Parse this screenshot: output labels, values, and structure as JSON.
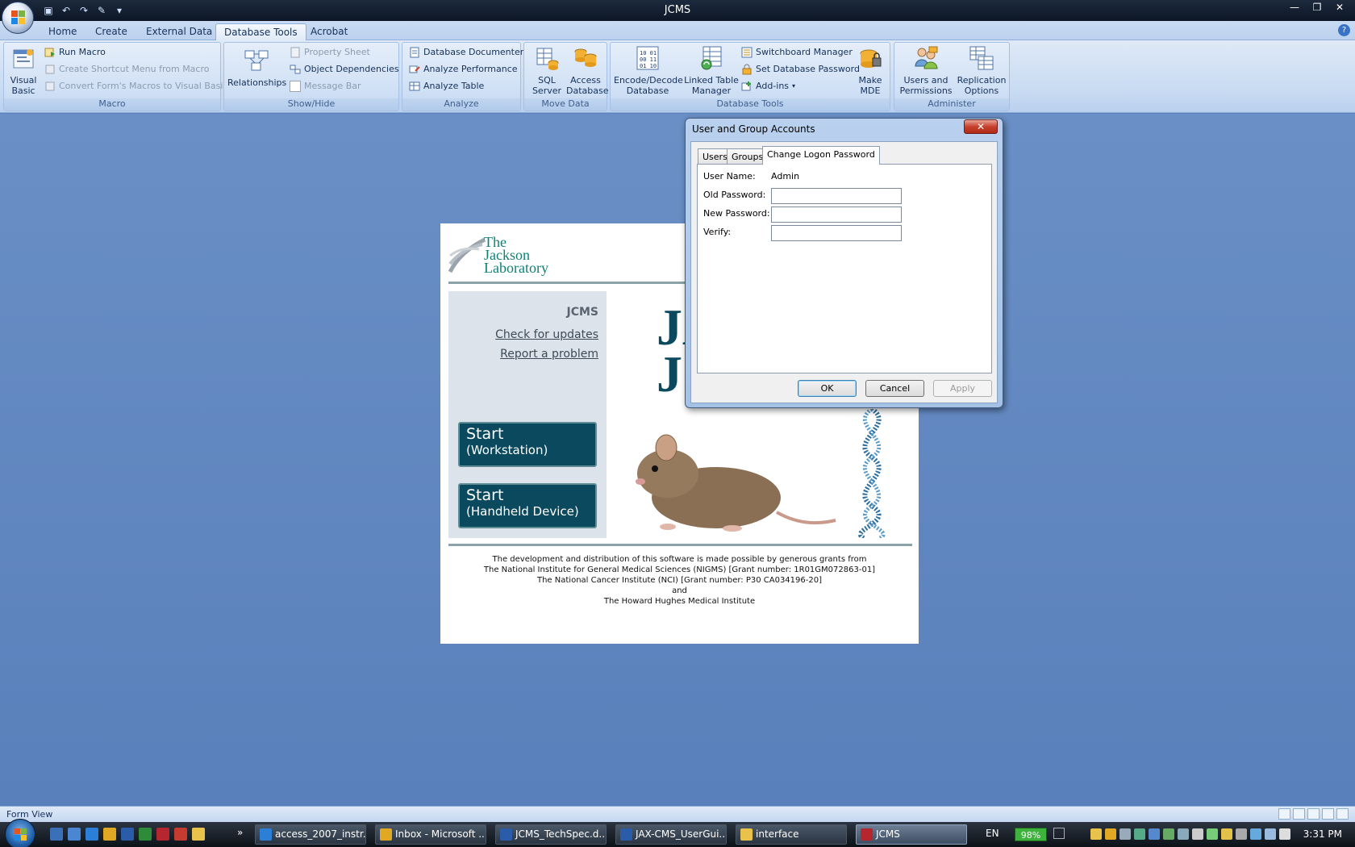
{
  "window": {
    "title": "JCMS",
    "controls": [
      "minimize-icon",
      "restore-icon",
      "close-icon"
    ]
  },
  "ribbon": {
    "tabs": [
      "Home",
      "Create",
      "External Data",
      "Database Tools",
      "Acrobat"
    ],
    "active_tab": "Database Tools",
    "groups": {
      "macro": {
        "label": "Macro",
        "visual_basic": "Visual\nBasic",
        "run_macro": "Run Macro",
        "create_shortcut_menu": "Create Shortcut Menu from Macro",
        "convert_macros": "Convert Form's Macros to Visual Basic"
      },
      "show_hide": {
        "label": "Show/Hide",
        "relationships": "Relationships",
        "property_sheet": "Property Sheet",
        "object_dependencies": "Object Dependencies",
        "message_bar": "Message Bar"
      },
      "analyze": {
        "label": "Analyze",
        "database_documenter": "Database Documenter",
        "analyze_performance": "Analyze Performance",
        "analyze_table": "Analyze Table"
      },
      "move_data": {
        "label": "Move Data",
        "sql_server": "SQL\nServer",
        "access_database": "Access\nDatabase"
      },
      "database_tools": {
        "label": "Database Tools",
        "encode_decode": "Encode/Decode\nDatabase",
        "linked_table_manager": "Linked Table\nManager",
        "switchboard_manager": "Switchboard Manager",
        "set_database_password": "Set Database Password",
        "add_ins": "Add-ins",
        "make_mde": "Make\nMDE"
      },
      "administer": {
        "label": "Administer",
        "users_permissions": "Users and\nPermissions",
        "replication_options": "Replication\nOptions"
      }
    }
  },
  "form": {
    "logo_text": [
      "The",
      "Jackson",
      "Laboratory"
    ],
    "panel_title": "JCMS",
    "check_updates": "Check for updates",
    "report_problem": "Report a problem",
    "start_workstation": {
      "title": "Start",
      "sub": "(Workstation)"
    },
    "start_handheld": {
      "title": "Start",
      "sub": "(Handheld Device)"
    },
    "big_letters": [
      "JA",
      "JC"
    ],
    "footer": [
      "The development and distribution of this software is made possible by generous grants from",
      "The National Institute for General Medical Sciences (NIGMS) [Grant number: 1R01GM072863-01]",
      "The National Cancer Institute (NCI)  [Grant number: P30 CA034196-20]",
      "and",
      "The Howard Hughes Medical Institute"
    ]
  },
  "dialog": {
    "title": "User and Group Accounts",
    "tabs": [
      "Users",
      "Groups",
      "Change Logon Password"
    ],
    "active_tab": "Change Logon Password",
    "user_name_label": "User Name:",
    "user_name_value": "Admin",
    "old_password_label": "Old Password:",
    "new_password_label": "New Password:",
    "verify_label": "Verify:",
    "old_password_value": "",
    "new_password_value": "",
    "verify_value": "",
    "ok": "OK",
    "cancel": "Cancel",
    "apply": "Apply"
  },
  "statusbar": {
    "text": "Form View"
  },
  "taskbar": {
    "items": [
      {
        "label": "access_2007_instr...",
        "icon": "ie-icon",
        "color": "#2b7fd6"
      },
      {
        "label": "Inbox - Microsoft ...",
        "icon": "outlook-icon",
        "color": "#e0a823"
      },
      {
        "label": "JCMS_TechSpec.d...",
        "icon": "word-icon",
        "color": "#2a5caa"
      },
      {
        "label": "JAX-CMS_UserGui...",
        "icon": "word-icon",
        "color": "#2a5caa"
      },
      {
        "label": "interface",
        "icon": "folder-icon",
        "color": "#e8c24a"
      },
      {
        "label": "JCMS",
        "icon": "access-icon",
        "color": "#b5262f"
      }
    ],
    "active_item": "JCMS",
    "language": "EN",
    "battery": "98%",
    "clock": "3:31 PM"
  },
  "colors": {
    "workspace": "#5d82bb",
    "teal_brand": "#0b4a5e",
    "jax_green": "#0f7f76"
  }
}
